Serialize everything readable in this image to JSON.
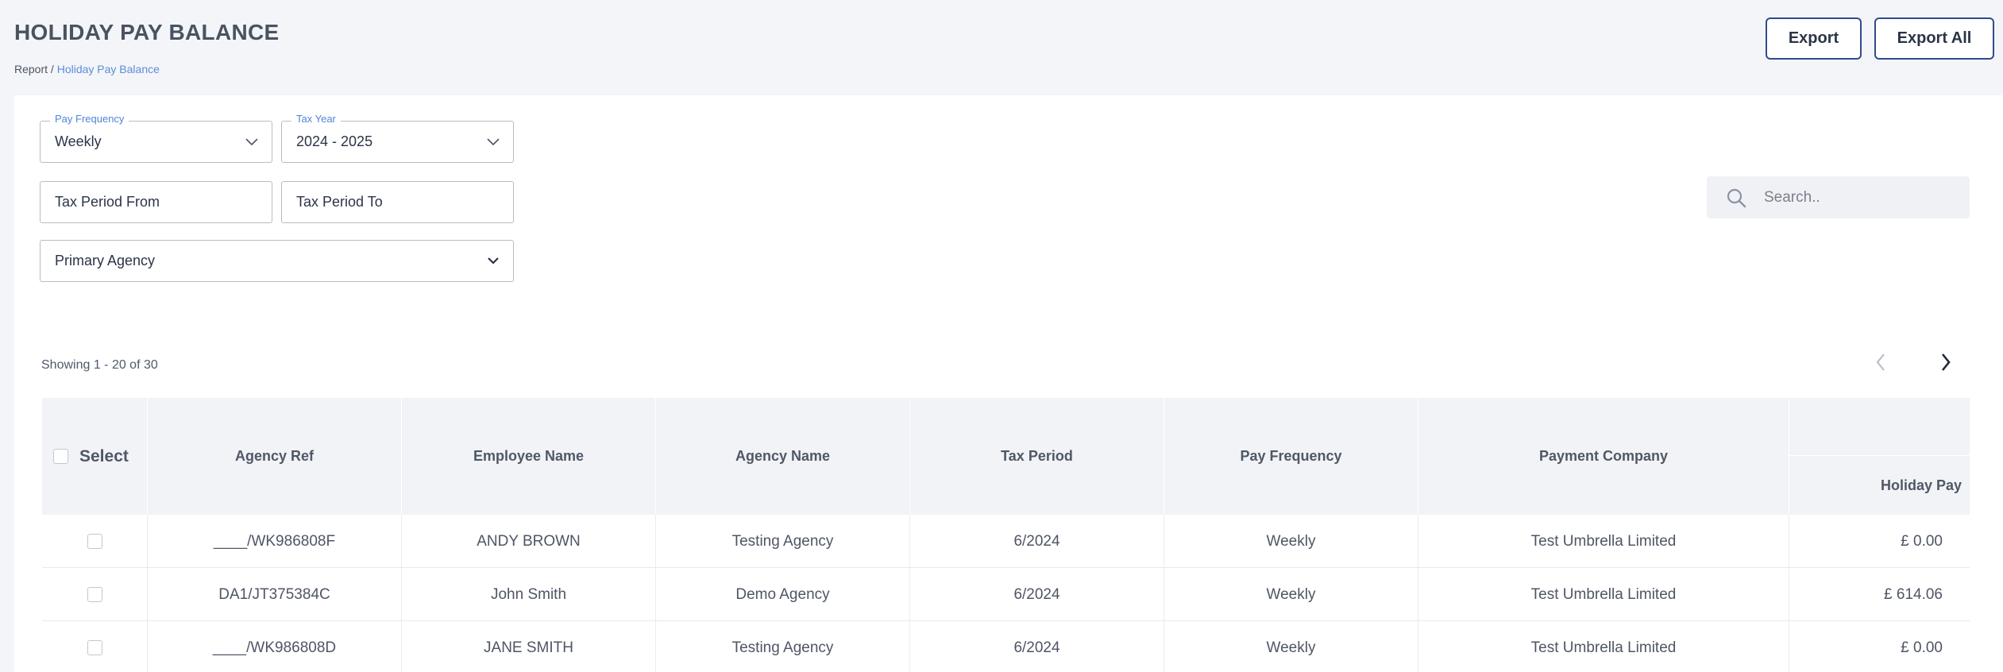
{
  "page": {
    "title": "HOLIDAY PAY BALANCE",
    "breadcrumb": {
      "root": "Report",
      "separator": " / ",
      "current": "Holiday Pay Balance"
    }
  },
  "actions": {
    "export_label": "Export",
    "export_all_label": "Export All"
  },
  "filters": {
    "pay_frequency": {
      "legend": "Pay Frequency",
      "value": "Weekly"
    },
    "tax_year": {
      "legend": "Tax Year",
      "value": "2024 - 2025"
    },
    "tax_period_from": {
      "placeholder": "Tax Period From"
    },
    "tax_period_to": {
      "placeholder": "Tax Period To"
    },
    "primary_agency": {
      "placeholder": "Primary Agency"
    }
  },
  "search": {
    "placeholder": "Search.."
  },
  "pagination": {
    "showing": "Showing 1 - 20 of 30"
  },
  "table": {
    "columns": {
      "select": "Select",
      "agency_ref": "Agency Ref",
      "employee_name": "Employee Name",
      "agency_name": "Agency Name",
      "tax_period": "Tax Period",
      "pay_frequency": "Pay Frequency",
      "payment_company": "Payment Company",
      "holiday_pay": "Holiday Pay"
    },
    "rows": [
      {
        "agency_ref": "____/WK986808F",
        "employee_name": "ANDY BROWN",
        "agency_name": "Testing Agency",
        "tax_period": "6/2024",
        "pay_frequency": "Weekly",
        "payment_company": "Test Umbrella Limited",
        "holiday_pay": "£ 0.00"
      },
      {
        "agency_ref": "DA1/JT375384C",
        "employee_name": "John Smith",
        "agency_name": "Demo Agency",
        "tax_period": "6/2024",
        "pay_frequency": "Weekly",
        "payment_company": "Test Umbrella Limited",
        "holiday_pay": "£ 614.06"
      },
      {
        "agency_ref": "____/WK986808D",
        "employee_name": "JANE SMITH",
        "agency_name": "Testing Agency",
        "tax_period": "6/2024",
        "pay_frequency": "Weekly",
        "payment_company": "Test Umbrella Limited",
        "holiday_pay": "£ 0.00"
      }
    ]
  },
  "colors": {
    "accent": "#2f4b8f",
    "link": "#5b8dd6",
    "background": "#f4f5f9",
    "header_bg": "#f2f3f6"
  },
  "icons": {
    "search": "search-icon",
    "dropdown": "chevron-down-icon",
    "prev": "chevron-left-icon",
    "next": "chevron-right-icon"
  }
}
